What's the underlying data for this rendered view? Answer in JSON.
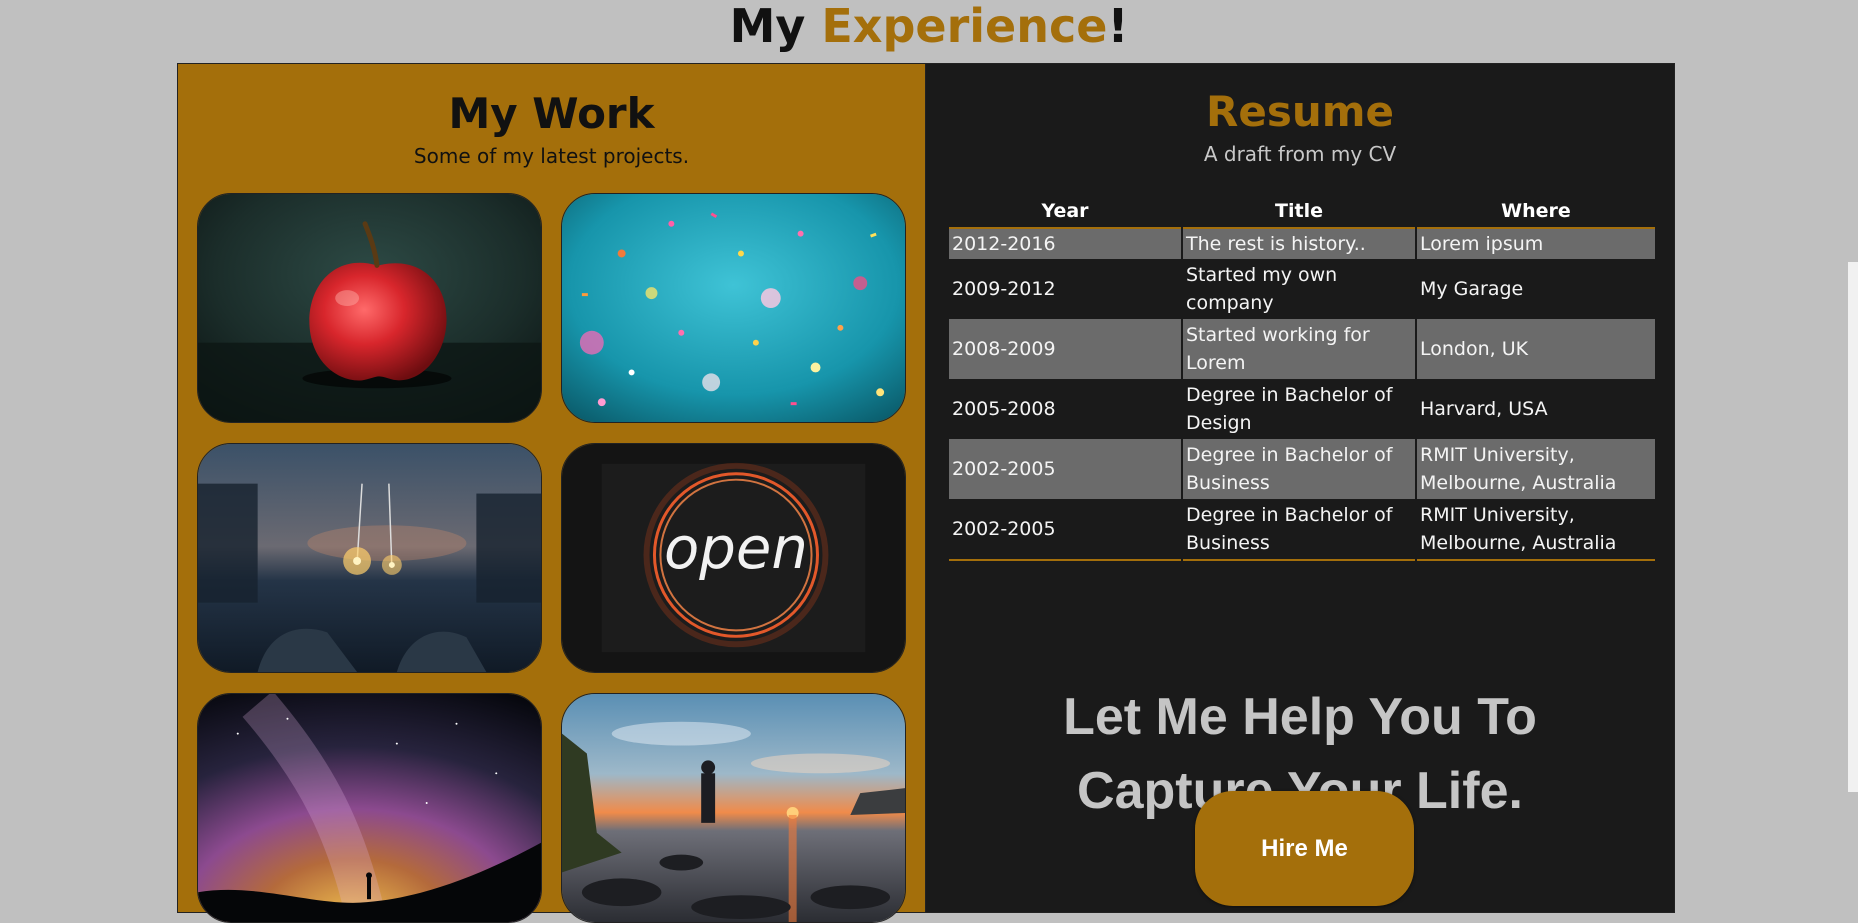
{
  "header": {
    "title_prefix": "My ",
    "title_accent": "Experience",
    "title_suffix": "!"
  },
  "work": {
    "title": "My Work",
    "subtitle": "Some of my latest projects.",
    "photos": [
      {
        "subject": "red apple"
      },
      {
        "subject": "confetti"
      },
      {
        "subject": "sparklers"
      },
      {
        "subject": "open neon sign"
      },
      {
        "subject": "milky way"
      },
      {
        "subject": "sunset shore"
      }
    ]
  },
  "resume": {
    "title": "Resume",
    "subtitle": "A draft from my CV",
    "columns": [
      "Year",
      "Title",
      "Where"
    ],
    "rows": [
      {
        "year": "2012-2016",
        "title": "The rest is history..",
        "where": "Lorem ipsum"
      },
      {
        "year": "2009-2012",
        "title": "Started my own company",
        "where": "My Garage"
      },
      {
        "year": "2008-2009",
        "title": "Started working for Lorem",
        "where": "London, UK"
      },
      {
        "year": "2005-2008",
        "title": "Degree in Bachelor of Design",
        "where": "Harvard, USA"
      },
      {
        "year": "2002-2005",
        "title": "Degree in Bachelor of Business",
        "where": "RMIT University, Melbourne, Australia"
      },
      {
        "year": "2002-2005",
        "title": "Degree in Bachelor of Business",
        "where": "RMIT University, Melbourne, Australia"
      }
    ]
  },
  "cta": {
    "line1": "Let Me Help You To",
    "line2": "Capture Your Life.",
    "button_label": "Hire Me"
  },
  "colors": {
    "accent": "#a46f0b",
    "dark_panel": "#1a1a1a",
    "page_bg": "#c0c0c0",
    "row_shade": "#6b6b6b"
  }
}
